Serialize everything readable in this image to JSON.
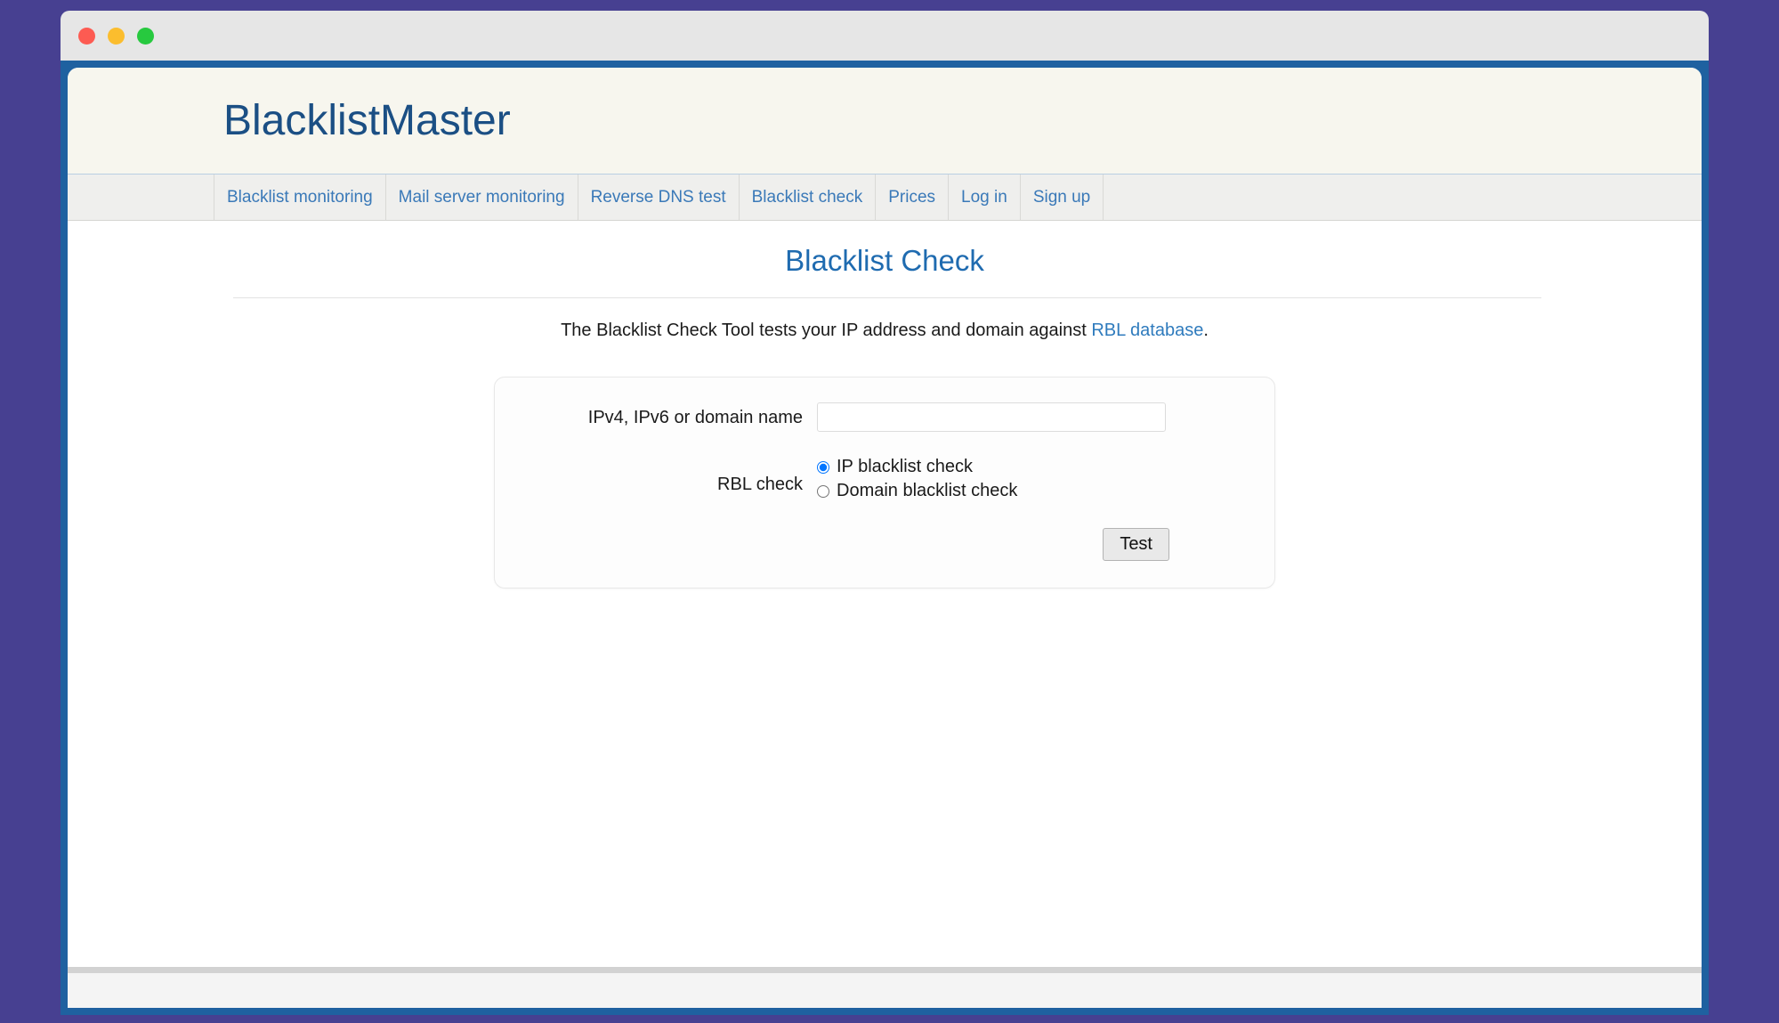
{
  "window": {
    "traffic_lights": [
      {
        "name": "close-button",
        "color": "#fd5b52"
      },
      {
        "name": "minimize-button",
        "color": "#fbbd2e"
      },
      {
        "name": "maximize-button",
        "color": "#27c93f"
      }
    ]
  },
  "site": {
    "logo": "BlacklistMaster",
    "logo_color": "#1b4f84",
    "frame_color": "#1f61a0",
    "desktop_color": "#474091"
  },
  "nav": {
    "items": [
      {
        "label": "Blacklist monitoring"
      },
      {
        "label": "Mail server monitoring"
      },
      {
        "label": "Reverse DNS test"
      },
      {
        "label": "Blacklist check"
      },
      {
        "label": "Prices"
      },
      {
        "label": "Log in"
      },
      {
        "label": "Sign up"
      }
    ],
    "link_color": "#3a79b8"
  },
  "main": {
    "title": "Blacklist Check",
    "title_color": "#1f6bb0",
    "intro_prefix": "The Blacklist Check Tool tests your IP address and domain against ",
    "intro_link": "RBL database",
    "intro_suffix": "."
  },
  "form": {
    "host_label": "IPv4, IPv6 or domain name",
    "host_value": "",
    "host_placeholder": "",
    "rbl_label": "RBL check",
    "options": [
      {
        "label": "IP blacklist check",
        "selected": true
      },
      {
        "label": "Domain blacklist check",
        "selected": false
      }
    ],
    "submit_label": "Test"
  }
}
